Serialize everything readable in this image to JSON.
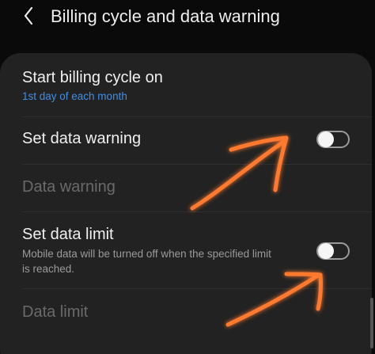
{
  "header": {
    "title": "Billing cycle and data warning",
    "back_icon": "chevron-left-icon"
  },
  "settings": {
    "billing_cycle": {
      "title": "Start billing cycle on",
      "value": "1st day of each month"
    },
    "data_warning_toggle": {
      "title": "Set data warning",
      "enabled": false
    },
    "data_warning_value": {
      "title": "Data warning"
    },
    "data_limit_toggle": {
      "title": "Set data limit",
      "description_line1": "Mobile data will be turned off when the specified limit",
      "description_line2": "is reached.",
      "enabled": false
    },
    "data_limit_value": {
      "title": "Data limit"
    }
  },
  "colors": {
    "accent": "#3f8ee6",
    "annotation_arrow": "#ff7a2e",
    "card_background": "#222222"
  }
}
